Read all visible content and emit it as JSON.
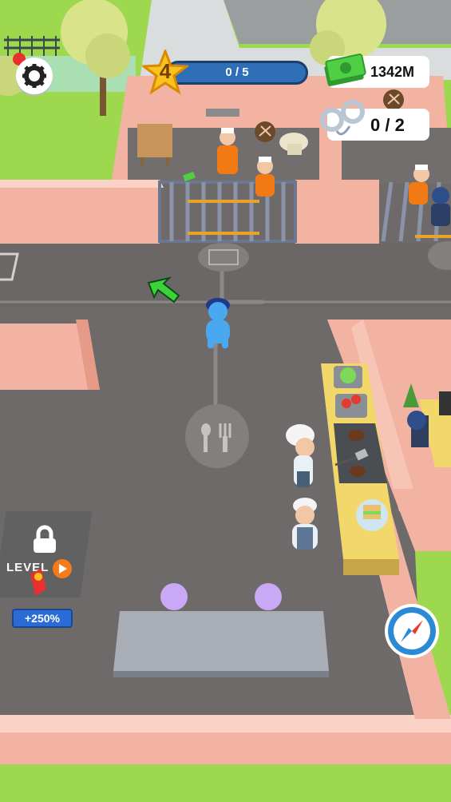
{
  "hud": {
    "level_number": "4",
    "level_progress_text": "0 / 5",
    "level_progress_fraction": 0,
    "money_text": "1342M",
    "prisoners_text": "0 / 2"
  },
  "locked_station": {
    "label": "LEVEL",
    "boost_text": "+250%"
  },
  "icons": [
    "gear-icon",
    "star-icon",
    "cash-icon",
    "handcuffs-icon",
    "lock-icon",
    "play-icon",
    "fork-spoon-icon",
    "compass-icon",
    "arrow-icon",
    "pickaxe-icon"
  ],
  "colors": {
    "floor": "#6e6a6a",
    "wall": "#f2b3a3",
    "grass": "#9ed84f",
    "bar_blue": "#2f6fb7",
    "money_green": "#4fd044",
    "counter_yellow": "#f2d76a"
  }
}
